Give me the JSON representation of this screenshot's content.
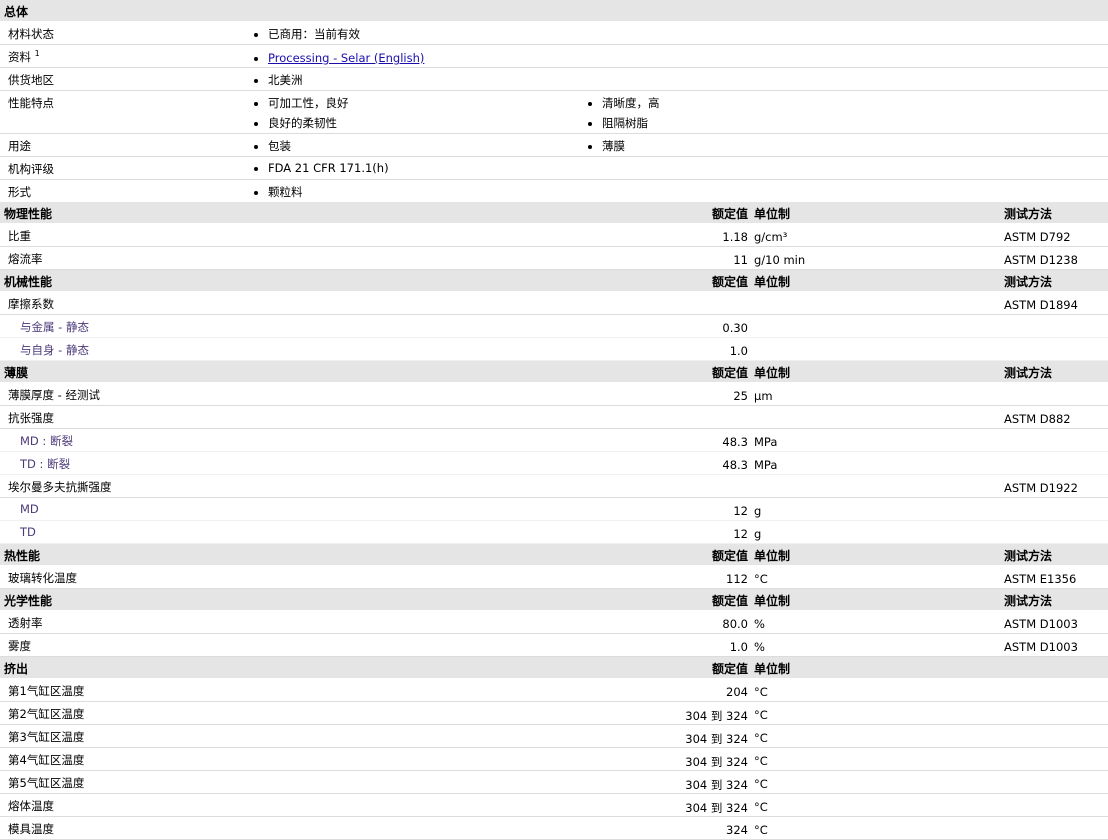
{
  "headers": {
    "value": "额定值",
    "unit": "单位制",
    "test": "测试方法"
  },
  "general": {
    "title": "总体",
    "rows": [
      {
        "label": "材料状态",
        "items": [
          "已商用：当前有效"
        ]
      },
      {
        "label": "资料",
        "sup": "1",
        "items": [
          "Processing - Selar (English)"
        ],
        "link": true
      },
      {
        "label": "供货地区",
        "items": [
          "北美洲"
        ]
      },
      {
        "label": "性能特点",
        "items": [
          "可加工性，良好",
          "清晰度，高",
          "良好的柔韧性",
          "阻隔树脂"
        ]
      },
      {
        "label": "用途",
        "items": [
          "包装",
          "薄膜"
        ]
      },
      {
        "label": "机构评级",
        "items": [
          "FDA 21 CFR 171.1(h)"
        ]
      },
      {
        "label": "形式",
        "items": [
          "颗粒料"
        ]
      }
    ]
  },
  "sections": [
    {
      "title": "物理性能",
      "rows": [
        {
          "label": "比重",
          "value": "1.18",
          "unit": "g/cm³",
          "test": "ASTM D792"
        },
        {
          "label": "熔流率",
          "value": "11",
          "unit": "g/10 min",
          "test": "ASTM D1238"
        }
      ]
    },
    {
      "title": "机械性能",
      "rows": [
        {
          "label": "摩擦系数",
          "value": "",
          "unit": "",
          "test": "ASTM D1894"
        },
        {
          "label": "与金属 - 静态",
          "value": "0.30",
          "unit": "",
          "test": "",
          "indent": true
        },
        {
          "label": "与自身 - 静态",
          "value": "1.0",
          "unit": "",
          "test": "",
          "indent": true
        }
      ]
    },
    {
      "title": "薄膜",
      "rows": [
        {
          "label": "薄膜厚度 - 经测试",
          "value": "25",
          "unit": "µm",
          "test": ""
        },
        {
          "label": "抗张强度",
          "value": "",
          "unit": "",
          "test": "ASTM D882"
        },
        {
          "label": "MD : 断裂",
          "value": "48.3",
          "unit": "MPa",
          "test": "",
          "indent": true
        },
        {
          "label": "TD : 断裂",
          "value": "48.3",
          "unit": "MPa",
          "test": "",
          "indent": true
        },
        {
          "label": "埃尔曼多夫抗撕强度",
          "value": "",
          "unit": "",
          "test": "ASTM D1922"
        },
        {
          "label": "MD",
          "value": "12",
          "unit": "g",
          "test": "",
          "indent": true
        },
        {
          "label": "TD",
          "value": "12",
          "unit": "g",
          "test": "",
          "indent": true
        }
      ]
    },
    {
      "title": "热性能",
      "rows": [
        {
          "label": "玻璃转化温度",
          "value": "112",
          "unit": "°C",
          "test": "ASTM E1356"
        }
      ]
    },
    {
      "title": "光学性能",
      "rows": [
        {
          "label": "透射率",
          "value": "80.0",
          "unit": "%",
          "test": "ASTM D1003"
        },
        {
          "label": "雾度",
          "value": "1.0",
          "unit": "%",
          "test": "ASTM D1003"
        }
      ]
    },
    {
      "title": "挤出",
      "notest": true,
      "rows": [
        {
          "label": "第1气缸区温度",
          "value": "204",
          "unit": "°C",
          "test": ""
        },
        {
          "label": "第2气缸区温度",
          "value": "304 到  324",
          "unit": "°C",
          "test": ""
        },
        {
          "label": "第3气缸区温度",
          "value": "304 到  324",
          "unit": "°C",
          "test": ""
        },
        {
          "label": "第4气缸区温度",
          "value": "304 到  324",
          "unit": "°C",
          "test": ""
        },
        {
          "label": "第5气缸区温度",
          "value": "304 到  324",
          "unit": "°C",
          "test": ""
        },
        {
          "label": "熔体温度",
          "value": "304 到  324",
          "unit": "°C",
          "test": ""
        },
        {
          "label": "模具温度",
          "value": "324",
          "unit": "°C",
          "test": ""
        }
      ]
    }
  ]
}
